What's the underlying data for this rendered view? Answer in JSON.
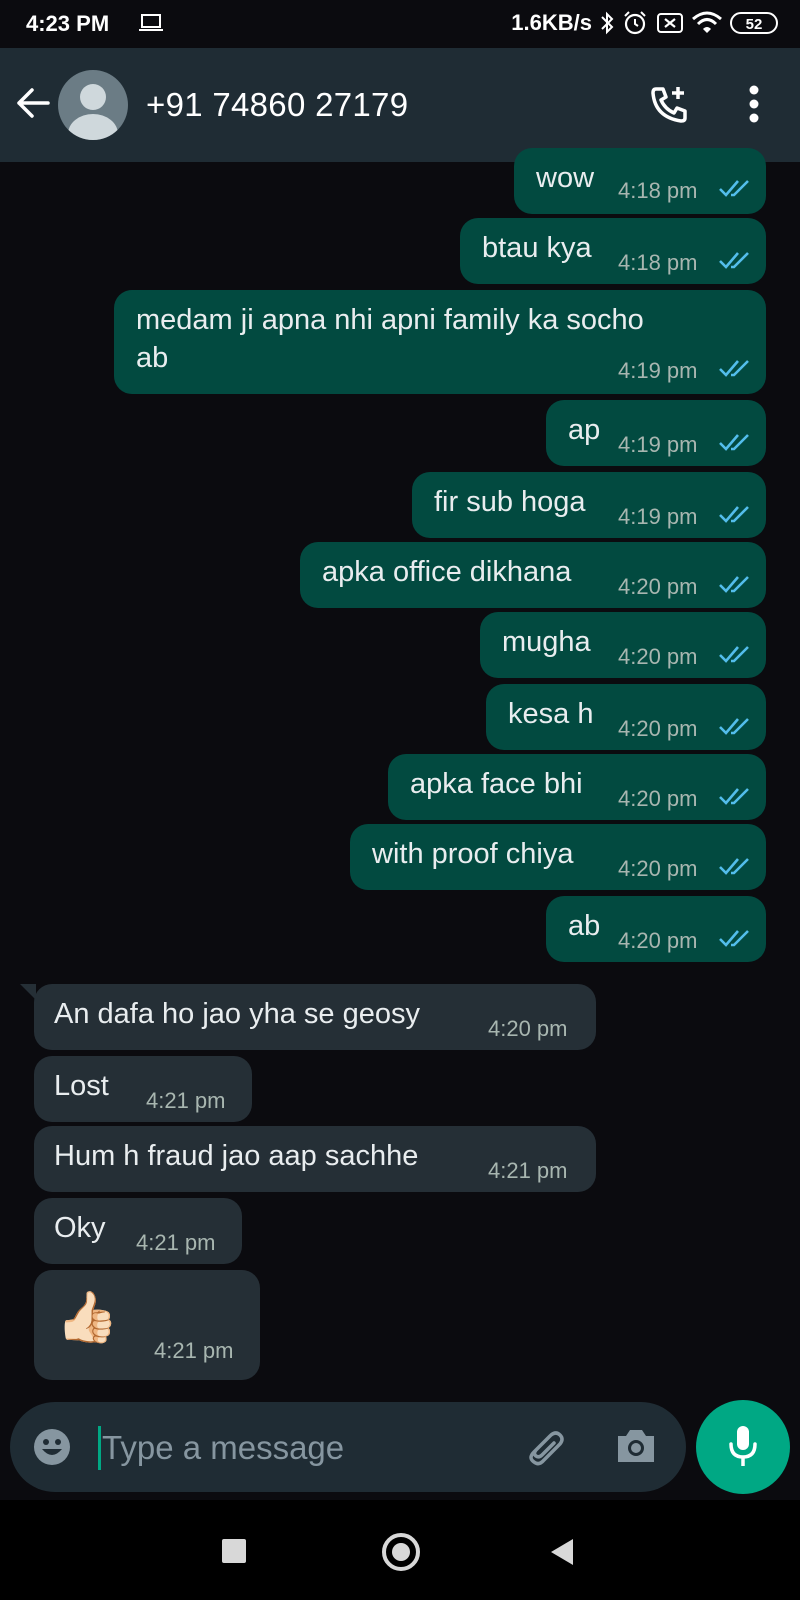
{
  "status_bar": {
    "time": "4:23 PM",
    "network_speed": "1.6KB/s",
    "battery": "52"
  },
  "header": {
    "contact": "+91 74860 27179"
  },
  "messages": [
    {
      "dir": "out",
      "text": "wow",
      "time": "4:18 pm"
    },
    {
      "dir": "out",
      "text": "btau kya",
      "time": "4:18 pm"
    },
    {
      "dir": "out",
      "text_line1": "medam ji apna nhi apni family ka socho",
      "text_line2": "ab",
      "time": "4:19 pm"
    },
    {
      "dir": "out",
      "text": "ap",
      "time": "4:19 pm"
    },
    {
      "dir": "out",
      "text": "fir sub hoga",
      "time": "4:19 pm"
    },
    {
      "dir": "out",
      "text": "apka office dikhana",
      "time": "4:20 pm"
    },
    {
      "dir": "out",
      "text": "mugha",
      "time": "4:20 pm"
    },
    {
      "dir": "out",
      "text": "kesa h",
      "time": "4:20 pm"
    },
    {
      "dir": "out",
      "text": "apka face bhi",
      "time": "4:20 pm"
    },
    {
      "dir": "out",
      "text": "with proof chiya",
      "time": "4:20 pm"
    },
    {
      "dir": "out",
      "text": "ab",
      "time": "4:20 pm"
    },
    {
      "dir": "in",
      "text": "An dafa ho jao yha se geosy",
      "time": "4:20 pm"
    },
    {
      "dir": "in",
      "text": "Lost",
      "time": "4:21 pm"
    },
    {
      "dir": "in",
      "text": "Hum h fraud jao aap sachhe",
      "time": "4:21 pm"
    },
    {
      "dir": "in",
      "text": "Oky",
      "time": "4:21 pm"
    },
    {
      "dir": "in",
      "emoji": "👍🏻",
      "time": "4:21 pm"
    }
  ],
  "composer": {
    "placeholder": "Type a message"
  },
  "colors": {
    "outgoing_bubble": "#024a40",
    "incoming_bubble": "#252f36",
    "header": "#1f2c34",
    "accent": "#00a884",
    "read_ticks": "#53bdeb"
  },
  "icons": [
    "back-arrow-icon",
    "avatar-icon",
    "add-call-icon",
    "more-vert-icon",
    "emoji-icon",
    "attach-icon",
    "camera-icon",
    "mic-icon"
  ]
}
